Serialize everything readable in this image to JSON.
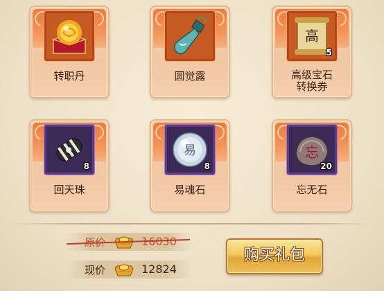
{
  "items": [
    {
      "name": "转职丹",
      "count": "",
      "icon": "orange-pill-icon",
      "frame": "orange"
    },
    {
      "name": "圆觉露",
      "count": "",
      "icon": "potion-bottle-icon",
      "frame": "orange"
    },
    {
      "name": "高级宝石\n转换券",
      "count": "5",
      "icon": "gem-voucher-scroll-icon",
      "frame": "orange"
    },
    {
      "name": "回天珠",
      "count": "8",
      "icon": "totem-bead-icon",
      "frame": "purple"
    },
    {
      "name": "易魂石",
      "count": "8",
      "icon": "soul-stone-icon",
      "frame": "purple"
    },
    {
      "name": "忘无石",
      "count": "20",
      "icon": "rune-stone-icon",
      "frame": "purple"
    }
  ],
  "price": {
    "original_label": "原价",
    "original_value": "16030",
    "current_label": "现价",
    "current_value": "12824",
    "currency_icon": "gold-ingot-icon"
  },
  "buy_button": {
    "label": "购买礼包"
  },
  "colors": {
    "card_top": "#ef7a3c",
    "orange_frame": "#b5461c",
    "purple_frame": "#5d3a8a",
    "original_price": "#b6542a",
    "strike": "#c0392b",
    "button_gold": "#f3c75a"
  }
}
